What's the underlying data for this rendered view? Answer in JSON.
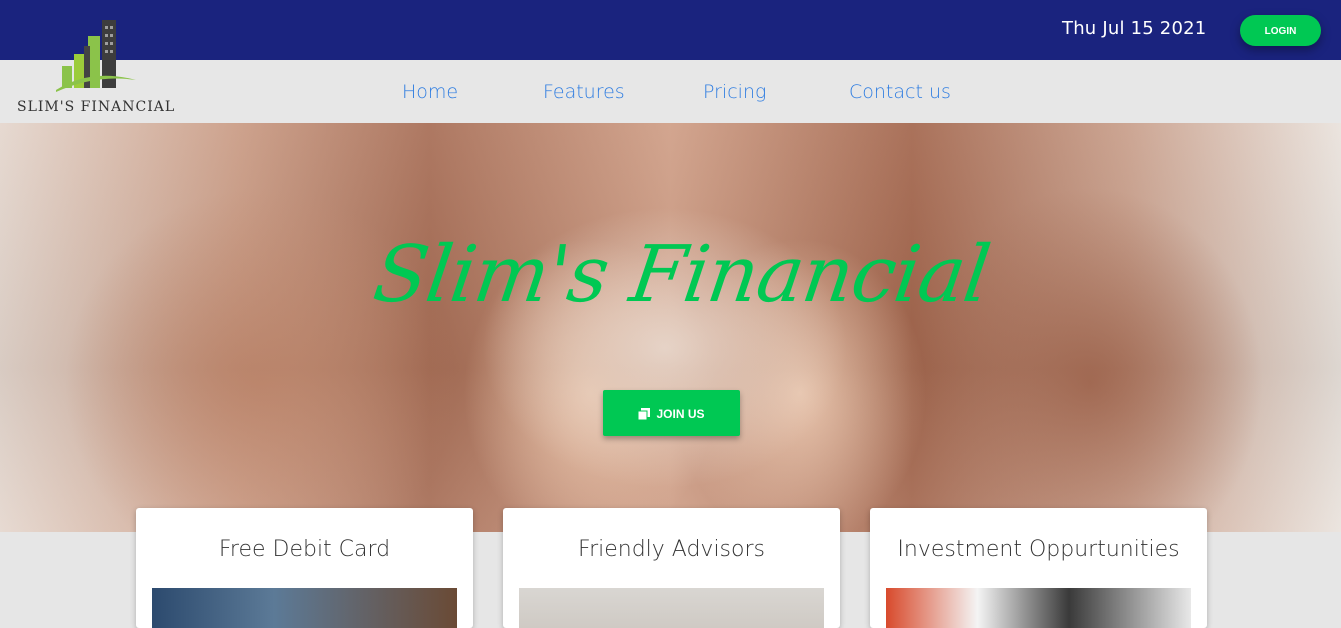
{
  "header": {
    "date": "Thu Jul 15 2021",
    "login_label": "LOGIN"
  },
  "brand": {
    "name": "SLIM'S FINANCIAL",
    "logo_icon": "building-chart-logo"
  },
  "nav": {
    "items": [
      "Home",
      "Features",
      "Pricing",
      "Contact us"
    ]
  },
  "hero": {
    "title": "Slim's Financial",
    "join_label": "JOIN US",
    "join_icon": "copy-icon"
  },
  "cards": [
    {
      "title": "Free Debit Card"
    },
    {
      "title": "Friendly Advisors"
    },
    {
      "title": "Investment Oppurtunities"
    }
  ],
  "colors": {
    "topbar": "#1a237e",
    "accent_green": "#00c853",
    "nav_link": "#2f7de1"
  }
}
